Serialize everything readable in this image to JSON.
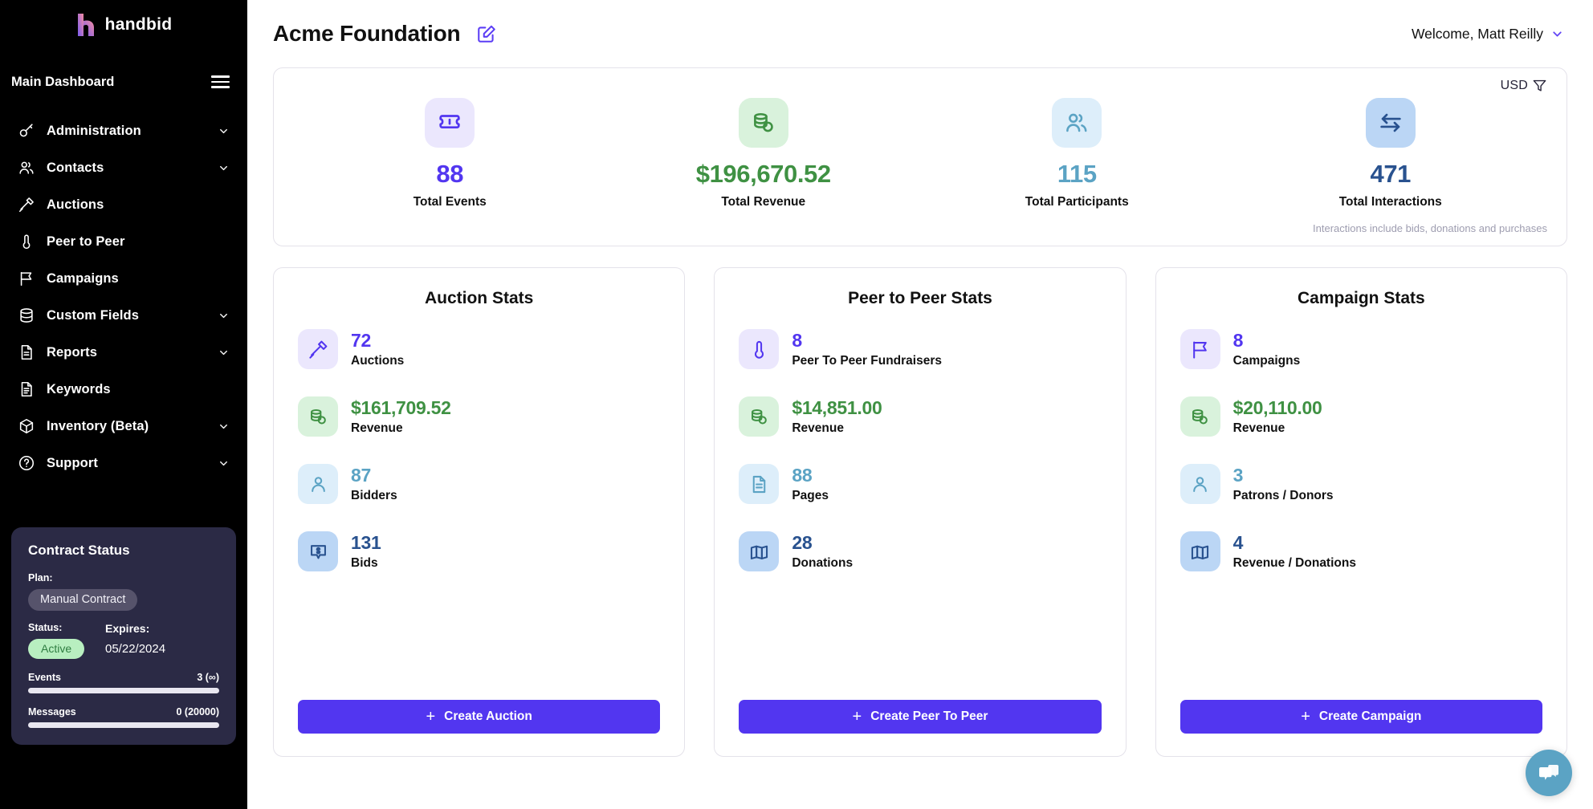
{
  "sidebar": {
    "logo_text": "handbid",
    "dashboard_label": "Main Dashboard",
    "items": [
      {
        "label": "Administration",
        "icon": "key-icon",
        "has_chevron": true
      },
      {
        "label": "Contacts",
        "icon": "contacts-icon",
        "has_chevron": true
      },
      {
        "label": "Auctions",
        "icon": "gavel-icon",
        "has_chevron": false
      },
      {
        "label": "Peer to Peer",
        "icon": "thermometer-icon",
        "has_chevron": false
      },
      {
        "label": "Campaigns",
        "icon": "flag-icon",
        "has_chevron": false
      },
      {
        "label": "Custom Fields",
        "icon": "database-icon",
        "has_chevron": true
      },
      {
        "label": "Reports",
        "icon": "report-icon",
        "has_chevron": true
      },
      {
        "label": "Keywords",
        "icon": "document-icon",
        "has_chevron": false
      },
      {
        "label": "Inventory (Beta)",
        "icon": "box-icon",
        "has_chevron": true
      },
      {
        "label": "Support",
        "icon": "question-circle-icon",
        "has_chevron": true
      }
    ],
    "contract": {
      "title": "Contract Status",
      "plan_label": "Plan:",
      "plan_value": "Manual Contract",
      "status_label": "Status:",
      "status_value": "Active",
      "expires_label": "Expires:",
      "expires_value": "05/22/2024",
      "meters": [
        {
          "name": "Events",
          "value": "3 (∞)",
          "percent": 0
        },
        {
          "name": "Messages",
          "value": "0 (20000)",
          "percent": 0
        }
      ]
    }
  },
  "header": {
    "org_name": "Acme Foundation",
    "edit_icon": "edit-square-icon",
    "welcome_text": "Welcome, Matt Reilly"
  },
  "summary": {
    "currency_label": "USD",
    "filter_icon": "funnel-icon",
    "note": "Interactions include bids, donations and purchases",
    "metrics": [
      {
        "value": "88",
        "label": "Total Events",
        "icon": "ticket-icon",
        "color": "#5236f0",
        "bg": "#ebe7fd"
      },
      {
        "value": "$196,670.52",
        "label": "Total Revenue",
        "icon": "coins-icon",
        "color": "#3f9143",
        "bg": "#d9f2dc"
      },
      {
        "value": "115",
        "label": "Total Participants",
        "icon": "people-icon",
        "color": "#5ba3c4",
        "bg": "#ddeefa"
      },
      {
        "value": "471",
        "label": "Total Interactions",
        "icon": "exchange-icon",
        "color": "#29528f",
        "bg": "#bbd6f5"
      }
    ]
  },
  "cards": [
    {
      "title": "Auction Stats",
      "rows": [
        {
          "value": "72",
          "label": "Auctions",
          "icon": "gavel-icon",
          "color": "#5236f0",
          "bg": "#ebe7fd"
        },
        {
          "value": "$161,709.52",
          "label": "Revenue",
          "icon": "coins-icon",
          "color": "#3f9143",
          "bg": "#d9f2dc"
        },
        {
          "value": "87",
          "label": "Bidders",
          "icon": "person-icon",
          "color": "#5ba3c4",
          "bg": "#ddeefa"
        },
        {
          "value": "131",
          "label": "Bids",
          "icon": "bid-icon",
          "color": "#29528f",
          "bg": "#bbd6f5"
        }
      ],
      "cta_label": "Create Auction",
      "cta_plus": "+"
    },
    {
      "title": "Peer to Peer Stats",
      "rows": [
        {
          "value": "8",
          "label": "Peer To Peer Fundraisers",
          "icon": "thermometer-icon",
          "color": "#5236f0",
          "bg": "#ebe7fd"
        },
        {
          "value": "$14,851.00",
          "label": "Revenue",
          "icon": "coins-icon",
          "color": "#3f9143",
          "bg": "#d9f2dc"
        },
        {
          "value": "88",
          "label": "Pages",
          "icon": "document-icon",
          "color": "#5ba3c4",
          "bg": "#ddeefa"
        },
        {
          "value": "28",
          "label": "Donations",
          "icon": "money-icon",
          "color": "#29528f",
          "bg": "#bbd6f5"
        }
      ],
      "cta_label": "Create Peer To Peer",
      "cta_plus": "+"
    },
    {
      "title": "Campaign Stats",
      "rows": [
        {
          "value": "8",
          "label": "Campaigns",
          "icon": "flag-icon",
          "color": "#5236f0",
          "bg": "#ebe7fd"
        },
        {
          "value": "$20,110.00",
          "label": "Revenue",
          "icon": "coins-icon",
          "color": "#3f9143",
          "bg": "#d9f2dc"
        },
        {
          "value": "3",
          "label": "Patrons / Donors",
          "icon": "person-icon",
          "color": "#5ba3c4",
          "bg": "#ddeefa"
        },
        {
          "value": "4",
          "label": "Revenue / Donations",
          "icon": "money-icon",
          "color": "#29528f",
          "bg": "#bbd6f5"
        }
      ],
      "cta_label": "Create Campaign",
      "cta_plus": "+"
    }
  ],
  "chat": {
    "icon": "chat-bubble-icon"
  },
  "colors": {
    "brand_purple": "#5236f0",
    "green": "#3f9143",
    "light_blue": "#5ba3c4",
    "dark_blue": "#29528f",
    "sidebar_bg": "#000000",
    "contract_bg": "#2b2a45"
  }
}
